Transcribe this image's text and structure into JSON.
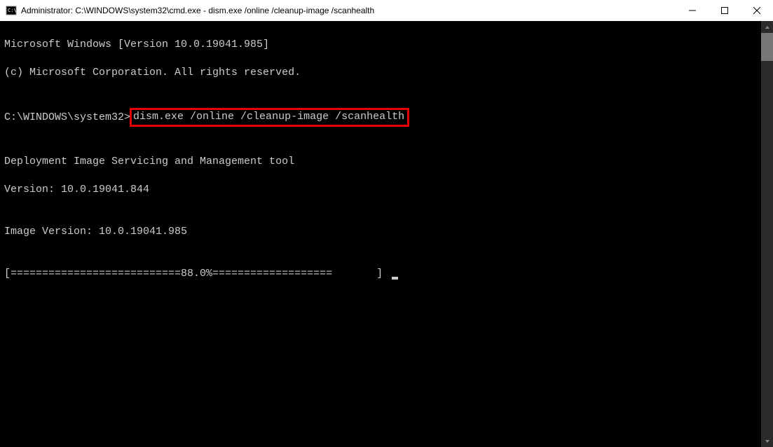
{
  "titlebar": {
    "text": "Administrator: C:\\WINDOWS\\system32\\cmd.exe - dism.exe  /online /cleanup-image /scanhealth"
  },
  "terminal": {
    "line1": "Microsoft Windows [Version 10.0.19041.985]",
    "line2": "(c) Microsoft Corporation. All rights reserved.",
    "blank1": "",
    "prompt_prefix": "C:\\WINDOWS\\system32>",
    "command": "dism.exe /online /cleanup-image /scanhealth",
    "blank2": "",
    "line3": "Deployment Image Servicing and Management tool",
    "line4": "Version: 10.0.19041.844",
    "blank3": "",
    "line5": "Image Version: 10.0.19041.985",
    "blank4": "",
    "progress": "[===========================88.0%===================       ] "
  }
}
